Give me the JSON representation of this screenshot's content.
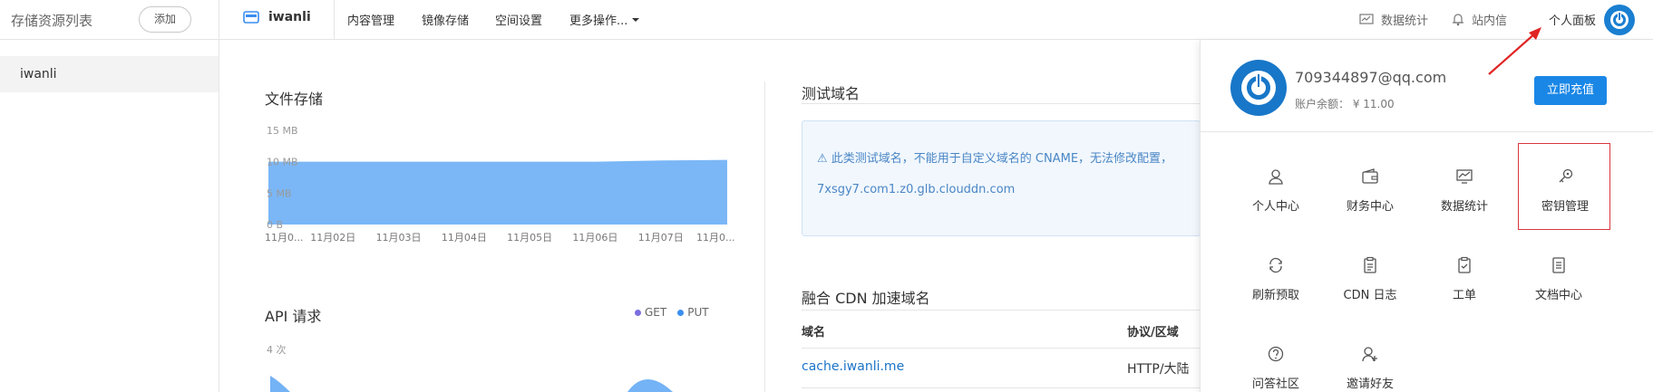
{
  "header": {
    "resource_list_title": "存储资源列表",
    "add_button": "添加",
    "bucket_name": "iwanli",
    "nav": [
      "内容管理",
      "镜像存储",
      "空间设置",
      "更多操作..."
    ],
    "stats_label": "数据统计",
    "messages_label": "站内信",
    "personal_panel_label": "个人面板"
  },
  "sidebar": {
    "items": [
      {
        "label": "iwanli",
        "selected": true
      }
    ]
  },
  "storage": {
    "title": "文件存储",
    "chart_data": {
      "type": "area",
      "x": [
        "11月0...",
        "11月02日",
        "11月03日",
        "11月04日",
        "11月05日",
        "11月06日",
        "11月07日",
        "11月0..."
      ],
      "yticks": [
        "15 MB",
        "10 MB",
        "5 MB",
        "0 B"
      ],
      "ylim": [
        0,
        15
      ],
      "series": [
        {
          "values": [
            10,
            10,
            10,
            10,
            10,
            10,
            10.2,
            10.3
          ]
        }
      ],
      "color": "#74b3f5"
    }
  },
  "api": {
    "title": "API 请求",
    "legend": [
      {
        "name": "GET",
        "color": "#7b6fe0"
      },
      {
        "name": "PUT",
        "color": "#3a8ef0"
      }
    ],
    "ytick_top": "4 次"
  },
  "test_domain": {
    "title": "测试域名",
    "warning": "⚠ 此类测试域名，不能用于自定义域名的 CNAME，无法修改配置，",
    "domain": "7xsgy7.com1.z0.glb.clouddn.com"
  },
  "cdn": {
    "title": "融合 CDN 加速域名",
    "columns": [
      "域名",
      "协议/区域"
    ],
    "rows": [
      {
        "domain": "cache.iwanli.me",
        "protocol": "HTTP/大陆"
      }
    ]
  },
  "panel": {
    "email": "709344897@qq.com",
    "balance": "账户余额： ¥ 11.00",
    "recharge_button": "立即充值",
    "items": [
      {
        "label": "个人中心",
        "icon": "user-icon"
      },
      {
        "label": "财务中心",
        "icon": "wallet-icon"
      },
      {
        "label": "数据统计",
        "icon": "chart-icon"
      },
      {
        "label": "密钥管理",
        "icon": "key-icon",
        "highlighted": true
      },
      {
        "label": "刷新预取",
        "icon": "refresh-icon"
      },
      {
        "label": "CDN 日志",
        "icon": "clipboard-icon"
      },
      {
        "label": "工单",
        "icon": "ticket-icon"
      },
      {
        "label": "文档中心",
        "icon": "document-icon"
      },
      {
        "label": "问答社区",
        "icon": "question-icon"
      },
      {
        "label": "邀请好友",
        "icon": "invite-icon"
      }
    ]
  },
  "colors": {
    "accent": "#1a87e6",
    "highlight": "#d9363e",
    "arrow": "#e02424"
  }
}
